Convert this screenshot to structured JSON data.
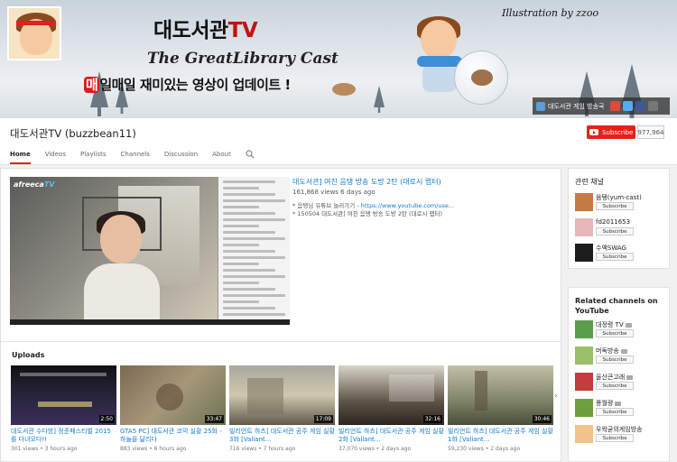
{
  "banner": {
    "title_main": "대도서관",
    "title_tv": "TV",
    "subtitle": "The GreatLibrary Cast",
    "tagline_mae": "매",
    "tagline_rest": "일매일 재미있는 영상이 업데이트 !",
    "illustration_credit": "Illustration by zzoo",
    "link_label": "대도서관 게임 방송국"
  },
  "channel": {
    "name": "대도서관TV (buzzbean11)",
    "subscribe_label": "Subscribe",
    "subscriber_count": "977,964",
    "tabs": [
      "Home",
      "Videos",
      "Playlists",
      "Channels",
      "Discussion",
      "About"
    ]
  },
  "featured": {
    "player_logo": "afreeca",
    "player_logo_tv": "TV",
    "title": "대도서관] 여친 음탱 방송 도방 2탄 (대로시 랩터)",
    "meta": "161,868 views  6 days ago",
    "desc_line1_prefix": "* 음탱님 유튜브 놀러가기 - ",
    "desc_line1_link": "https://www.youtube.com/use...",
    "desc_line2": "* 150504 대도서관] 여친 음탱 방송 도방 2탄 (대로시 랩터)"
  },
  "uploads": {
    "heading": "Uploads",
    "next": "›",
    "items": [
      {
        "title": "대도서관 수다방] 정준페스티벌 2015를 다녀오다!!",
        "duration": "2:50",
        "meta": "301 views  • 3 hours ago"
      },
      {
        "title": "GTA5 PC] 대도서관 코믹 실황 25화 - 하늘을 달리다",
        "duration": "33:47",
        "meta": "883 views  • 6 hours ago"
      },
      {
        "title": "빌리언트 하츠] 대도서관 공주 게임 실황 3화 [Valiant...",
        "duration": "17:09",
        "meta": "716 views  • 7 hours ago"
      },
      {
        "title": "빌리언트 하츠] 대도서관 공주 게임 실황 2화 [Valiant...",
        "duration": "32:16",
        "meta": "37,070 views  • 2 days ago"
      },
      {
        "title": "빌리언트 하츠] 대도서관 공주 게임 실황 1화 [Valiant...",
        "duration": "30:46",
        "meta": "59,230 views  • 2 days ago"
      }
    ]
  },
  "sidebar": {
    "related_heading": "관련 채널",
    "related": [
      {
        "name": "음탱(yum-cast)",
        "subscribe": "Subscribe"
      },
      {
        "name": "fd2011653",
        "subscribe": "Subscribe"
      },
      {
        "name": "수액SWAG",
        "subscribe": "Subscribe"
      }
    ],
    "youtube_heading": "Related channels on YouTube",
    "youtube": [
      {
        "name": "대정령 TV",
        "subscribe": "Subscribe"
      },
      {
        "name": "머독방송",
        "subscribe": "Subscribe"
      },
      {
        "name": "울산큰고래",
        "subscribe": "Subscribe"
      },
      {
        "name": "풍월량",
        "subscribe": "Subscribe"
      },
      {
        "name": "우왁굳의게임방송",
        "subscribe": "Subscribe"
      }
    ]
  }
}
